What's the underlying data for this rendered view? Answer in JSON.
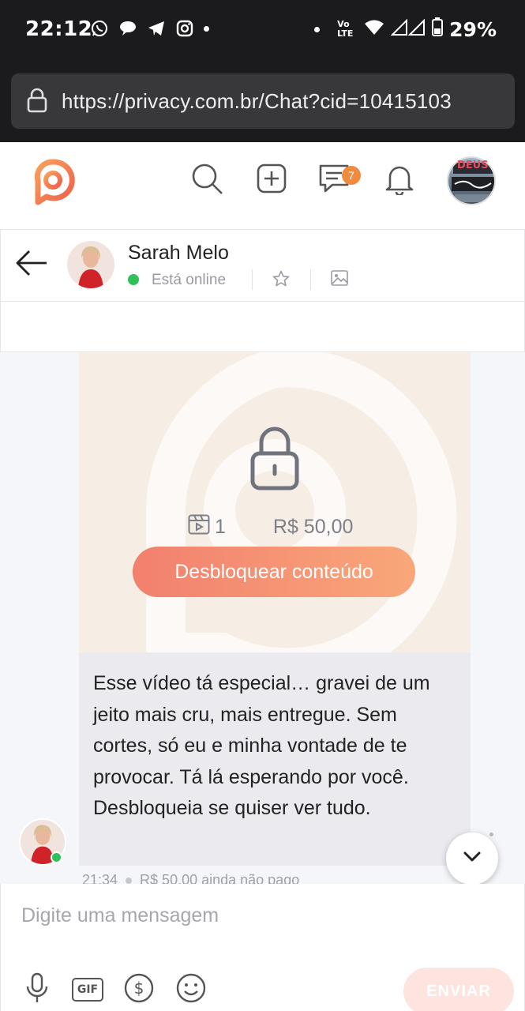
{
  "status_bar": {
    "time": "22:12",
    "network": "Vo LTE",
    "battery": "29%",
    "left_icons": [
      "whatsapp-icon",
      "chat-bubble-icon",
      "telegram-icon",
      "instagram-icon"
    ]
  },
  "browser": {
    "url": "https://privacy.com.br/Chat?cid=10415103"
  },
  "app_header": {
    "messages_badge": "7",
    "profile_avatar_text": "DEUS"
  },
  "chat_header": {
    "contact_name": "Sarah Melo",
    "status": "Está online"
  },
  "locked_content": {
    "media_count": "1",
    "price": "R$ 50,00",
    "unlock_label": "Desbloquear conteúdo"
  },
  "message": {
    "text": "Esse vídeo tá especial… gravei de um jeito mais cru, mais entregue. Sem cortes, só eu e minha vontade de te provocar. Tá lá esperando por você. Desbloqueia se quiser ver tudo.",
    "time": "21:34",
    "payment_status": "R$ 50,00 ainda não pago"
  },
  "composer": {
    "placeholder": "Digite uma mensagem",
    "gif_label": "GIF",
    "send_label": "ENVIAR"
  },
  "colors": {
    "accent": "#f27b5e",
    "online": "#2fc25b",
    "badge": "#f08a3e"
  }
}
